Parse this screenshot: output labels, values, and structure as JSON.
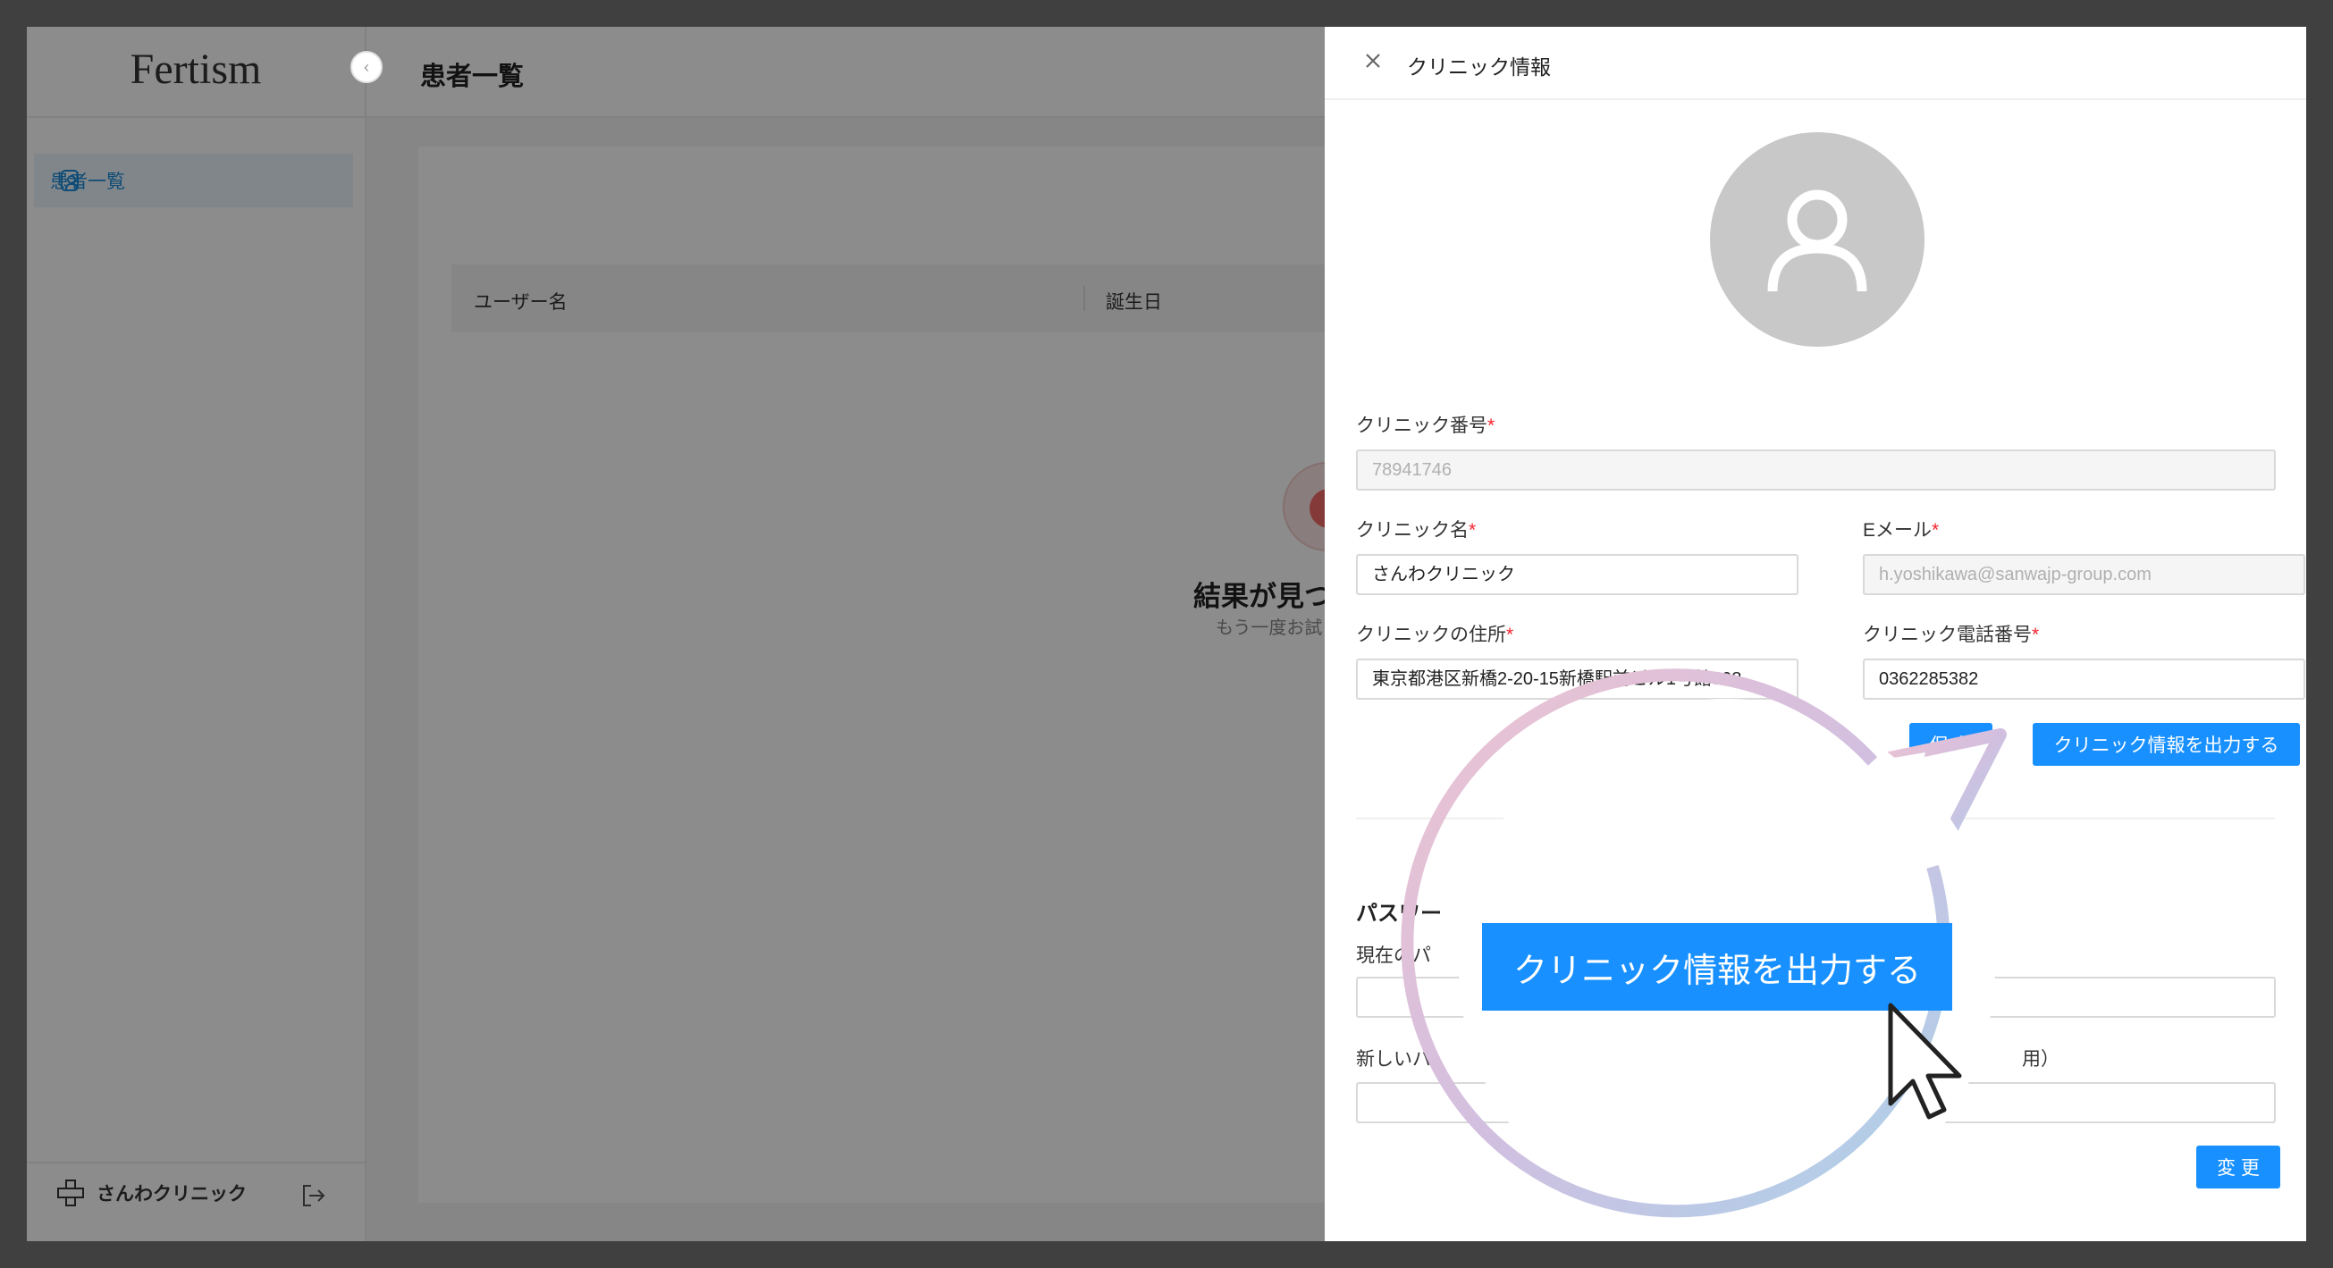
{
  "app": {
    "logo": "Fertism"
  },
  "sidebar": {
    "items": [
      {
        "label": "患者一覧",
        "icon": "patient-card-icon"
      }
    ],
    "footer": {
      "clinic_name": "さんわクリニック",
      "icons": [
        "clinic-cross-icon",
        "logout-icon"
      ]
    }
  },
  "header": {
    "title": "患者一覧"
  },
  "table": {
    "columns": [
      "ユーザー名",
      "誕生日"
    ]
  },
  "empty_state": {
    "title": "結果が見つ",
    "subtitle": "もう一度お試"
  },
  "drawer": {
    "title": "クリニック情報",
    "close_icon": "close-icon",
    "avatar_icon": "user-icon",
    "fields": {
      "clinic_number": {
        "label": "クリニック番号",
        "required": "*",
        "value": "78941746"
      },
      "clinic_name": {
        "label": "クリニック名",
        "required": "*",
        "value": "さんわクリニック"
      },
      "email": {
        "label": "Eメール",
        "required": "*",
        "value": "h.yoshikawa@sanwajp-group.com"
      },
      "address": {
        "label": "クリニックの住所",
        "required": "*",
        "value": "東京都港区新橋2-20-15新橋駅前ビル1号館808"
      },
      "phone": {
        "label": "クリニック電話番号",
        "required": "*",
        "value": "0362285382"
      }
    },
    "buttons": {
      "save": "保 存",
      "export": "クリニック情報を出力する"
    },
    "password": {
      "title": "パスワー",
      "current_label": "現在のパ",
      "new_label": "新しいパ",
      "confirm_label_fragment": "用）",
      "change_button": "変 更"
    }
  },
  "callout": {
    "zoom_label": "クリニック情報を出力する",
    "cursor_icon": "mouse-pointer-icon"
  },
  "colors": {
    "primary": "#1890ff",
    "active_nav": "#1c8ad8",
    "required": "#f5222d",
    "lens_ring_pink": "#eec3d1",
    "lens_ring_purple": "#d2bfe0",
    "lens_ring_blue": "#a9d2ea"
  }
}
